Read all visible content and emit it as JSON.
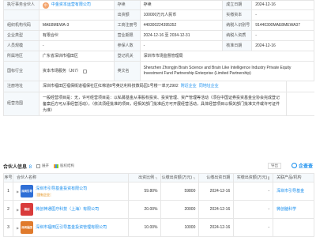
{
  "registration": {
    "partner_label": "执行事务合伙人",
    "partner_avatar": "中",
    "partner_name": "中金资本运营有限公司",
    "status_label": "存续",
    "status_value": "存续",
    "established_label": "成立日期",
    "established_value": "2024-12-16",
    "capital_label": "出资额",
    "capital_value": "100000万元人民币",
    "paidin_label": "实缴资本",
    "paidin_value": "-",
    "credit_code_label": "统一社会信用代码",
    "credit_code_value": "91440300MAE8MEWA37",
    "org_code_label": "组织机构代码",
    "org_code_value": "MAE8MEWA-3",
    "reg_no_label": "工商注册号",
    "reg_no_value": "440300224395352",
    "taxpayer_label": "纳税人识别号",
    "taxpayer_value": "91440300MAE8MEWA37",
    "type_label": "企业类型",
    "type_value": "有限合伙",
    "term_label": "营业期限",
    "term_value": "2024-12-16 至 2034-12-31",
    "qualification_label": "纳税人资质",
    "qualification_value": "-",
    "staff_label": "人员规模",
    "staff_value": "-",
    "insured_label": "参保人数",
    "insured_value": "-",
    "approval_label": "核准日期",
    "approval_value": "2024-12-16",
    "region_label": "所属地区",
    "region_value": "广东省深圳市福田区",
    "authority_label": "登记机关",
    "authority_value": "深圳市市场监督管理局",
    "industry_label": "国标行业",
    "industry_value": "资本市场服务（J67）",
    "english_label": "英文名",
    "english_value": "Shenzhen Zhongjin Brain Science and Brain Like Intelligence Industry Private Equity Investment Fund Partnership Enterprise (Limited Partnership)",
    "address_label": "注册地址",
    "address_value": "深圳市福田区福保街道福保社区红棉道8号英达利科技数码园1号楼一单元2902",
    "address_link1": "附近企业",
    "address_link2": "同地址企业",
    "scope_label": "经营范围",
    "scope_value": "一般经营项目是：无，许可经营项目是：以私募基金从事股权投资、投资管理、资产管理等活动（须在中国证券投资基金业协会完成登记备案后方可从事经营活动）。（依法须经批准的项目，经相关部门批准后方可开展经营活动，具体经营项目以相关部门批准文件或许可证件为准）"
  },
  "shareholders": {
    "title": "合伙人信息",
    "count": "8",
    "checkbox_label": "展开",
    "chart_label": "股权结构",
    "export_label": "导出",
    "brand": "企查查",
    "headers": {
      "index": "序号",
      "name": "合伙人名称",
      "ratio": "出资比例",
      "amount": "认缴出资额(万元)",
      "date": "认缴出资日期",
      "paid": "实缴出资额(万元)",
      "related": "关联产品/机构"
    },
    "rows": [
      {
        "index": "1",
        "logo": "深圳引导",
        "logo_color": "#2f6fd6",
        "name": "深圳市引导基金投资有限公司",
        "tag": "国有企业",
        "ratio": "59.80%",
        "amount": "59800",
        "date": "2024-12-16",
        "paid": "-",
        "related": "深圳市引导基金"
      },
      {
        "index": "2",
        "logo": "微创",
        "logo_color": "#d93b3b",
        "name": "微创神通医疗科技（上海）有限公司",
        "tag": "",
        "ratio": "20.00%",
        "amount": "20000",
        "date": "2024-12-16",
        "paid": "-",
        "related": "微创脑科学"
      },
      {
        "index": "3",
        "logo": "深圳福田",
        "logo_color": "#e07a2c",
        "name": "深圳市福田区引导基金投资管理有限公司",
        "tag": "",
        "ratio": "10.00%",
        "amount": "10000",
        "date": "2024-12-16",
        "paid": "-",
        "related": ""
      }
    ]
  }
}
